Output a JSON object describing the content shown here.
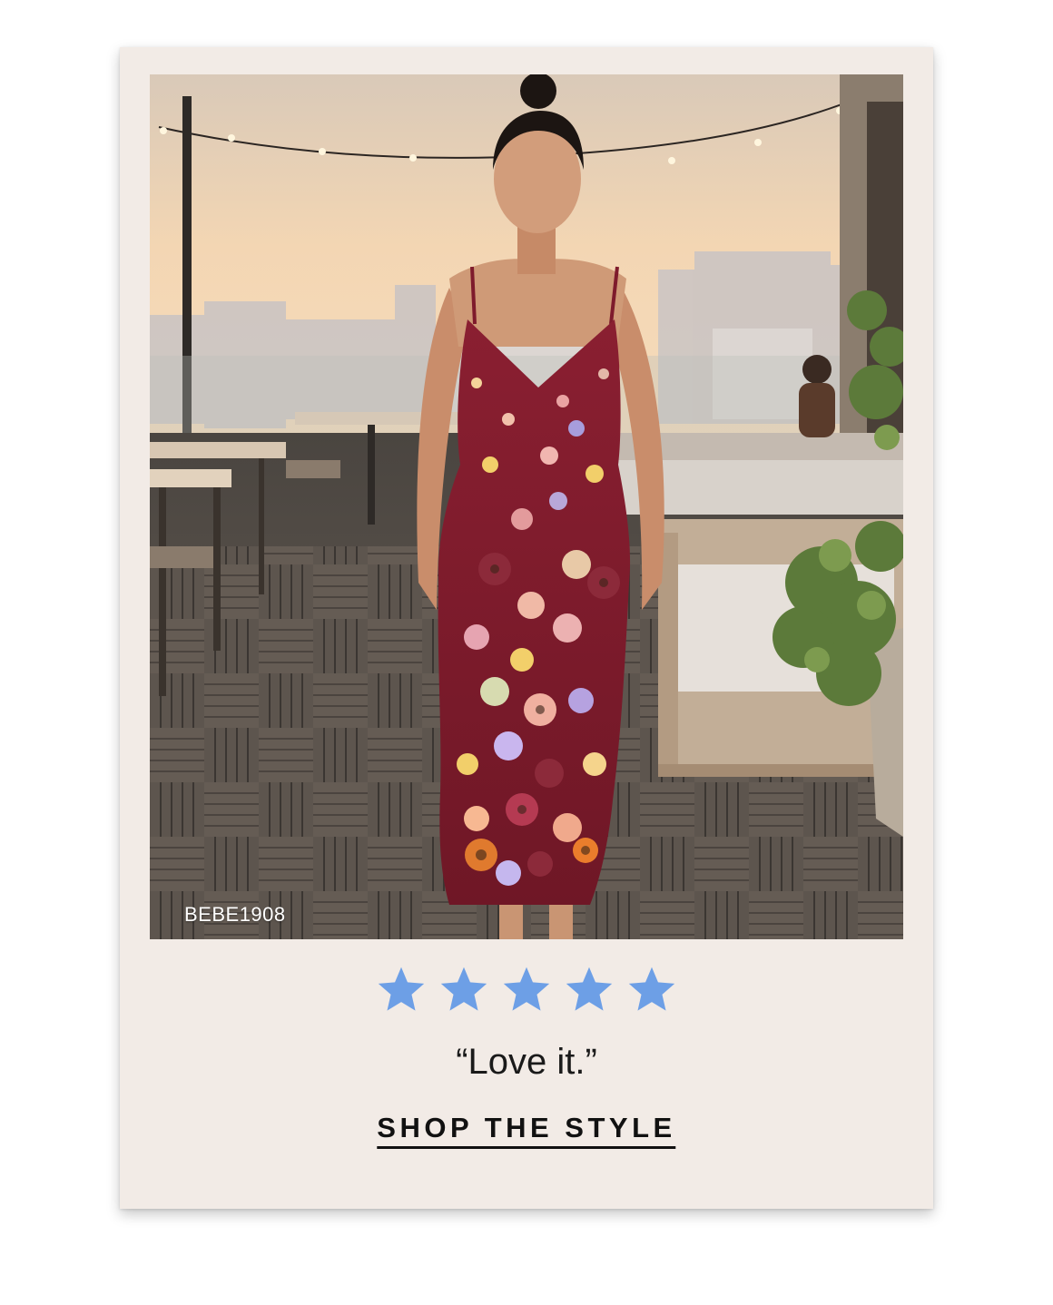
{
  "product": {
    "sku": "BEBE1908",
    "image_alt": "Woman wearing a burgundy floral embroidered midi dress on a rooftop terrace at sunset"
  },
  "review": {
    "rating": 5,
    "max_rating": 5,
    "star_color": "#6d9fe6",
    "quote": "“Love it.”"
  },
  "cta": {
    "label": "SHOP THE STYLE"
  },
  "colors": {
    "card_background": "#f2ebe6",
    "dress": "#7e1b2c"
  }
}
